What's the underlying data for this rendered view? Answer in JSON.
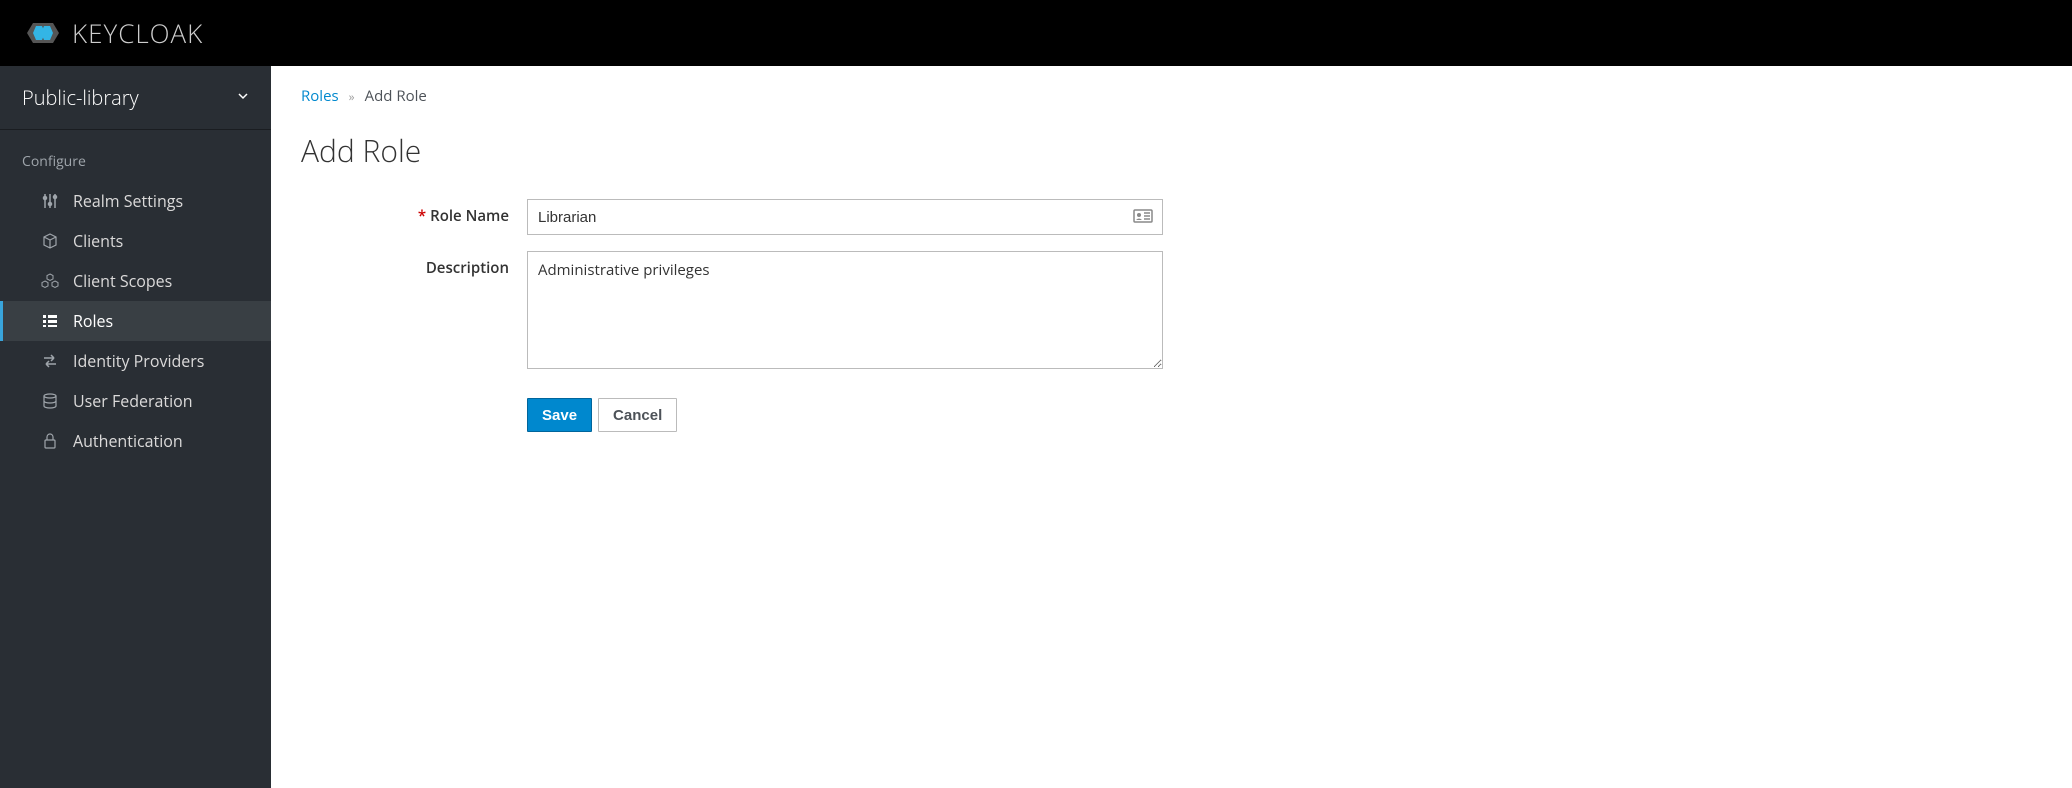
{
  "brand": {
    "name": "KEYCLOAK"
  },
  "realm": {
    "name": "Public-library"
  },
  "sidebar": {
    "section_label": "Configure",
    "items": [
      {
        "label": "Realm Settings",
        "icon": "sliders-icon",
        "active": false
      },
      {
        "label": "Clients",
        "icon": "cube-icon",
        "active": false
      },
      {
        "label": "Client Scopes",
        "icon": "cubes-icon",
        "active": false
      },
      {
        "label": "Roles",
        "icon": "list-icon",
        "active": true
      },
      {
        "label": "Identity Providers",
        "icon": "exchange-icon",
        "active": false
      },
      {
        "label": "User Federation",
        "icon": "database-icon",
        "active": false
      },
      {
        "label": "Authentication",
        "icon": "lock-icon",
        "active": false
      }
    ]
  },
  "breadcrumb": {
    "link": "Roles",
    "current": "Add Role"
  },
  "page": {
    "title": "Add Role"
  },
  "form": {
    "role_name_label": "Role Name",
    "role_name_value": "Librarian",
    "description_label": "Description",
    "description_value": "Administrative privileges",
    "save_label": "Save",
    "cancel_label": "Cancel"
  }
}
